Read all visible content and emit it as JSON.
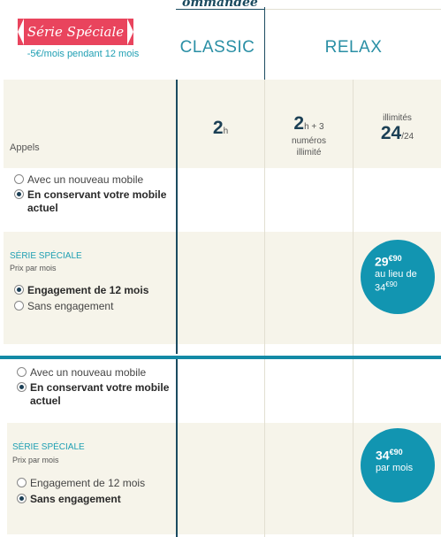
{
  "promo": {
    "ribbon_label": "Série Spéciale",
    "subtitle": "-5€/mois pendant 12 mois"
  },
  "recommended_tag": "ommandée",
  "plans": [
    {
      "name": "CLASSIC"
    },
    {
      "name": "RELAX"
    }
  ],
  "calls": {
    "label": "Appels",
    "classic": {
      "hours": "2",
      "unit": "h"
    },
    "relax": {
      "hours": "2",
      "unit": "h + 3",
      "extra1": "numéros",
      "extra2": "illimité"
    },
    "unlimited": {
      "top": "illimités",
      "big": "24",
      "unit": "/24"
    }
  },
  "section1": {
    "mobile_options": [
      {
        "label": "Avec un nouveau mobile",
        "selected": false
      },
      {
        "label": "En conservant votre mobile actuel",
        "selected": true
      }
    ],
    "serie_label": "SÉRIE SPÉCIALE",
    "prix_label": "Prix par mois",
    "engagement_options": [
      {
        "label": "Engagement de 12 mois",
        "selected": true
      },
      {
        "label": "Sans engagement",
        "selected": false
      }
    ],
    "price": {
      "euros": "29",
      "cents": "€90",
      "line1": "au lieu de",
      "old_euros": "34",
      "old_cents": "€90"
    }
  },
  "section2": {
    "mobile_options": [
      {
        "label": "Avec un nouveau mobile",
        "selected": false
      },
      {
        "label": "En conservant votre mobile actuel",
        "selected": true
      }
    ],
    "serie_label": "SÉRIE SPÉCIALE",
    "prix_label": "Prix par mois",
    "engagement_options": [
      {
        "label": "Engagement de 12 mois",
        "selected": false
      },
      {
        "label": "Sans engagement",
        "selected": true
      }
    ],
    "price": {
      "euros": "34",
      "cents": "€90",
      "line1": "par mois"
    }
  },
  "colors": {
    "accent": "#1295b1",
    "ribbon": "#e9445d",
    "dark": "#1b3f55",
    "beige": "#f6f4ea"
  }
}
